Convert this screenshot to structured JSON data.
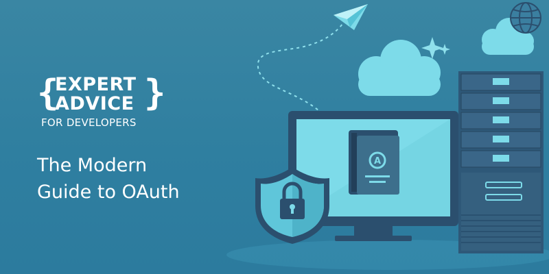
{
  "logo": {
    "brace_open": "{",
    "line1": "EXPERT",
    "line2": "ADVICE",
    "line3": "FOR DEVELOPERS",
    "brace_close": "}"
  },
  "headline": {
    "line1": "The Modern",
    "line2": "Guide to OAuth"
  },
  "book": {
    "badge_letter": "A"
  },
  "icons": [
    "paper-plane-icon",
    "cloud-icon",
    "globe-icon",
    "sparkle-icon",
    "shield-lock-icon",
    "book-icon",
    "monitor-icon",
    "server-rack-icon"
  ],
  "colors": {
    "background": "#3083a4",
    "accent_cyan": "#7ddbe9",
    "dark_navy": "#2b4f6e",
    "text": "#ffffff"
  }
}
